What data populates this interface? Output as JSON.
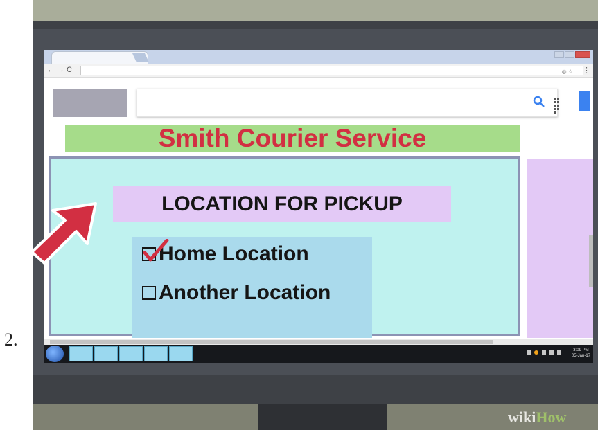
{
  "step": {
    "number": "2."
  },
  "page": {
    "banner_title": "Smith Courier Service",
    "section_heading": "LOCATION FOR PICKUP",
    "options": [
      {
        "label": "Home Location",
        "checked": true
      },
      {
        "label": "Another Location",
        "checked": false
      }
    ]
  },
  "taskbar": {
    "clock_time": "3:09 PM",
    "clock_date": "05-Jan-17"
  },
  "watermark": {
    "part1": "wiki",
    "part2": "How"
  },
  "icons": {
    "search": "search-icon",
    "apps": "apps-grid-icon",
    "pointer": "red-arrow-icon",
    "checkmark": "checkmark-icon"
  },
  "colors": {
    "banner_bg": "#a6dc8a",
    "banner_text": "#d22f42",
    "panel_bg": "#bff2ef",
    "heading_bg": "#e3c9f6",
    "options_bg": "#aadaec",
    "accent_blue": "#3b82f0"
  }
}
